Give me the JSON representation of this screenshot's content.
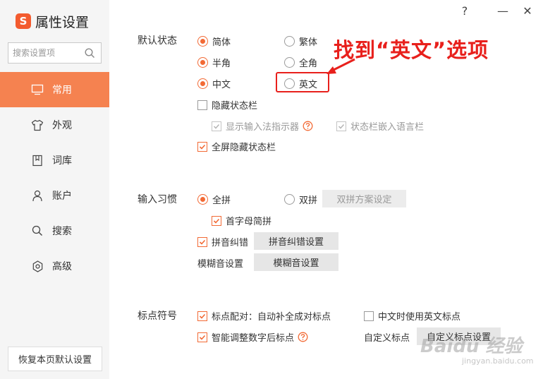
{
  "app": {
    "logo_text": "S",
    "title": "属性设置"
  },
  "window": {
    "help": "?",
    "minimize": "—",
    "close": "✕"
  },
  "search": {
    "placeholder": "搜索设置项",
    "icon": "search-icon"
  },
  "sidebar": {
    "items": [
      {
        "label": "常用",
        "icon": "monitor-icon",
        "active": true
      },
      {
        "label": "外观",
        "icon": "shirt-icon",
        "active": false
      },
      {
        "label": "词库",
        "icon": "dictionary-icon",
        "active": false
      },
      {
        "label": "账户",
        "icon": "user-icon",
        "active": false
      },
      {
        "label": "搜索",
        "icon": "search-icon",
        "active": false
      },
      {
        "label": "高级",
        "icon": "gear-icon",
        "active": false
      }
    ],
    "restore_label": "恢复本页默认设置"
  },
  "default_state": {
    "label": "默认状态",
    "simplified": {
      "label": "简体",
      "checked": true
    },
    "traditional": {
      "label": "繁体",
      "checked": false
    },
    "half_width": {
      "label": "半角",
      "checked": true
    },
    "full_width": {
      "label": "全角",
      "checked": false
    },
    "chinese": {
      "label": "中文",
      "checked": true
    },
    "english": {
      "label": "英文",
      "checked": false
    },
    "hide_status_bar": {
      "label": "隐藏状态栏",
      "checked": false
    },
    "show_indicator": {
      "label": "显示输入法指示器",
      "checked": true,
      "disabled": true
    },
    "embed_lang_bar": {
      "label": "状态栏嵌入语言栏",
      "checked": true,
      "disabled": true
    },
    "fullscreen_hide": {
      "label": "全屏隐藏状态栏",
      "checked": true
    }
  },
  "input_habits": {
    "label": "输入习惯",
    "full_pinyin": {
      "label": "全拼",
      "checked": true
    },
    "double_pinyin": {
      "label": "双拼",
      "checked": false
    },
    "double_pinyin_settings": "双拼方案设定",
    "initial_abbrev": {
      "label": "首字母简拼",
      "checked": true
    },
    "pinyin_correction": {
      "label": "拼音纠错",
      "checked": true
    },
    "pinyin_correction_settings": "拼音纠错设置",
    "fuzzy_label": "模糊音设置",
    "fuzzy_settings": "模糊音设置"
  },
  "punctuation": {
    "label": "标点符号",
    "pairing": {
      "label": "标点配对：自动补全成对标点",
      "checked": true
    },
    "english_punct": {
      "label": "中文时使用英文标点",
      "checked": false
    },
    "smart_adjust": {
      "label": "智能调整数字后标点",
      "checked": true
    },
    "custom_label": "自定义标点",
    "custom_settings": "自定义标点设置"
  },
  "annotation": {
    "text": "找到“英文”选项"
  },
  "watermark": {
    "text": "Baidu 经验",
    "url": "jingyan.baidu.com"
  },
  "colors": {
    "accent": "#f58250",
    "checked": "#f26a35",
    "annotation": "#e8201c"
  }
}
